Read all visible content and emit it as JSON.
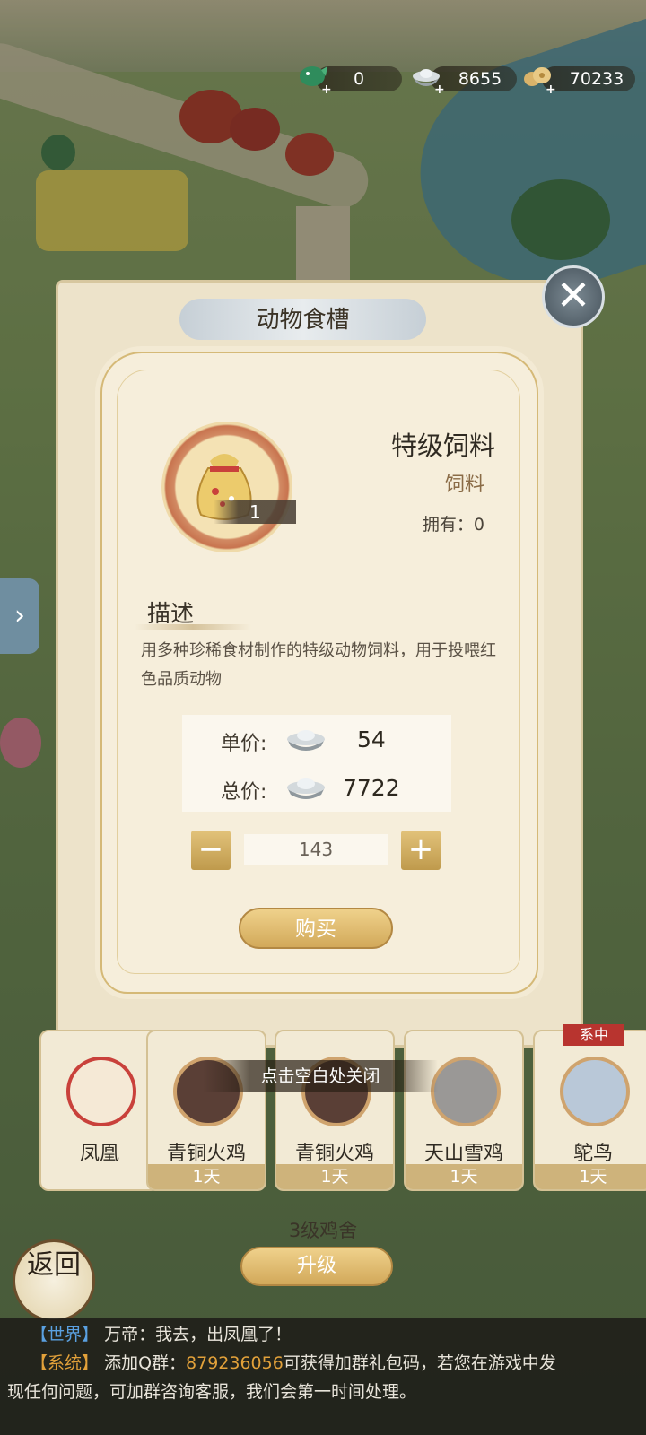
{
  "currencies": [
    {
      "icon": "jade-fish-icon",
      "value": "0"
    },
    {
      "icon": "silver-ingot-icon",
      "value": "8655"
    },
    {
      "icon": "gold-coins-icon",
      "value": "70233"
    }
  ],
  "back_panel": {
    "title": "动物食槽"
  },
  "dialog": {
    "item_name": "特级饲料",
    "item_type": "饲料",
    "item_qty_badge": "1",
    "owned": "拥有：0",
    "desc_title": "描述",
    "desc_text": "用多种珍稀食材制作的特级动物饲料，用于投喂红色品质动物",
    "unit_price_label": "单价:",
    "unit_price": "54",
    "total_price_label": "总价:",
    "total_price": "7722",
    "quantity": "143",
    "minus_symbol": "−",
    "plus_symbol": "+",
    "buy_label": "购买"
  },
  "hint": "点击空白处关闭",
  "tag_mid": "系中",
  "animals": [
    {
      "name": "凤凰",
      "days": ""
    },
    {
      "name": "青铜火鸡",
      "days": "1天"
    },
    {
      "name": "青铜火鸡",
      "days": "1天"
    },
    {
      "name": "天山雪鸡",
      "days": "1天"
    },
    {
      "name": "鸵鸟",
      "days": "1天"
    }
  ],
  "coop": {
    "level_label": "3级鸡舍",
    "upgrade_label": "升级"
  },
  "return_label": "返回",
  "chat": {
    "line1_channel": "【世界】",
    "line1_text": "万帝：我去，出凤凰了！",
    "line2_channel": "【系统】",
    "line2_text_a": "添加Q群：",
    "line2_qq": "879236056",
    "line2_text_b": "可获得加群礼包码，若您在游戏中发",
    "line3_text": "现任何问题，可加群咨询客服，我们会第一时间处理。"
  },
  "colors": {
    "accent_gold": "#d2a95a",
    "chat_world": "#5aa0e0",
    "chat_system": "#e2a13a"
  }
}
